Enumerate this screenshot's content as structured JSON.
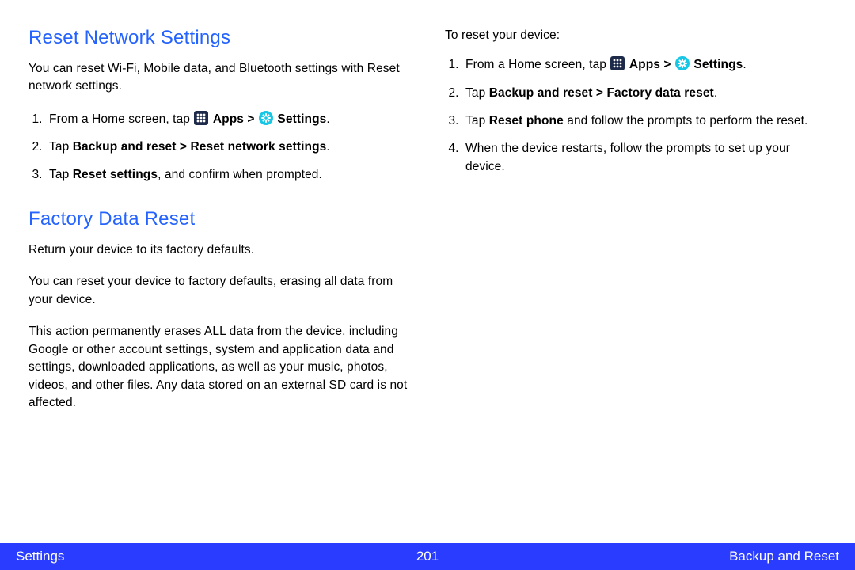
{
  "left": {
    "heading1": "Reset Network Settings",
    "intro1": "You can reset Wi-Fi, Mobile data, and Bluetooth settings with Reset network settings.",
    "step1_pre": "From a Home screen, tap ",
    "step1_apps": "Apps > ",
    "step1_settings": "Settings",
    "step1_post": ".",
    "step2_pre": "Tap ",
    "step2_bold": "Backup and reset > Reset network settings",
    "step2_post": ".",
    "step3_pre": "Tap ",
    "step3_bold": "Reset settings",
    "step3_post": ", and confirm when prompted.",
    "heading2": "Factory Data Reset",
    "para2a": "Return your device to its factory defaults.",
    "para2b": "You can reset your device to factory defaults, erasing all data from your device.",
    "para2c": "This action permanently erases ALL data from the device, including Google or other account settings, system and application data and settings, downloaded applications, as well as your music, photos, videos, and other files. Any data stored on an external SD card is not affected."
  },
  "right": {
    "intro": "To reset your device:",
    "step1_pre": "From a Home screen, tap ",
    "step1_apps": "Apps > ",
    "step1_settings": "Settings",
    "step1_post": ".",
    "step2_pre": "Tap ",
    "step2_bold": "Backup and reset > Factory data reset",
    "step2_post": ".",
    "step3_pre": "Tap ",
    "step3_bold": "Reset phone",
    "step3_post": " and follow the prompts to perform the reset.",
    "step4": "When the device restarts, follow the prompts to set up your device."
  },
  "footer": {
    "left": "Settings",
    "center": "201",
    "right": "Backup and Reset"
  }
}
